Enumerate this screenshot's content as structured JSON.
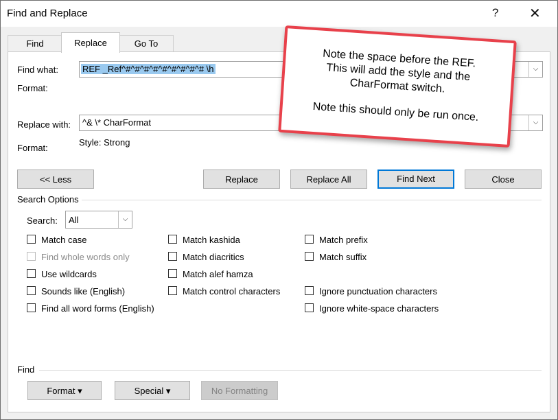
{
  "window": {
    "title": "Find and Replace",
    "help_glyph": "?",
    "close_glyph": "✕"
  },
  "tabs": [
    {
      "label": "Find",
      "active": false
    },
    {
      "label": "Replace",
      "active": true
    },
    {
      "label": "Go To",
      "active": false
    }
  ],
  "find": {
    "label": "Find what:",
    "value": "REF _Ref^#^#^#^#^#^#^#^#^# \\h",
    "format_label": "Format:",
    "format_value": ""
  },
  "replace": {
    "label": "Replace with:",
    "value": "^& \\* CharFormat",
    "format_label": "Format:",
    "format_value": "Style: Strong"
  },
  "buttons": {
    "less": "<< Less",
    "replace": "Replace",
    "replace_all": "Replace All",
    "find_next": "Find Next",
    "close": "Close"
  },
  "search_options": {
    "heading": "Search Options",
    "search_label": "Search:",
    "search_value": "All",
    "col1": [
      {
        "label": "Match case",
        "checked": false,
        "disabled": false
      },
      {
        "label": "Find whole words only",
        "checked": false,
        "disabled": true
      },
      {
        "label": "Use wildcards",
        "checked": false,
        "disabled": false
      },
      {
        "label": "Sounds like (English)",
        "checked": false,
        "disabled": false
      },
      {
        "label": "Find all word forms (English)",
        "checked": false,
        "disabled": false
      }
    ],
    "col2": [
      {
        "label": "Match kashida",
        "checked": false
      },
      {
        "label": "Match diacritics",
        "checked": false
      },
      {
        "label": "Match alef hamza",
        "checked": false
      },
      {
        "label": "Match control characters",
        "checked": false
      }
    ],
    "col3": [
      {
        "label": "Match prefix",
        "checked": false
      },
      {
        "label": "Match suffix",
        "checked": false
      },
      {
        "label": "Ignore punctuation characters",
        "checked": false
      },
      {
        "label": "Ignore white-space characters",
        "checked": false
      }
    ]
  },
  "find_section": {
    "heading": "Find",
    "format_button": "Format ▾",
    "special_button": "Special ▾",
    "no_formatting_button": "No Formatting"
  },
  "callout": {
    "line1": "Note the space before the REF.",
    "line2": "This will add the style and the",
    "line3": "CharFormat switch.",
    "line4": "Note this should only be run once."
  },
  "colors": {
    "accent": "#0078d7",
    "callout_border": "#e8414b",
    "selection": "#99c9ef"
  }
}
